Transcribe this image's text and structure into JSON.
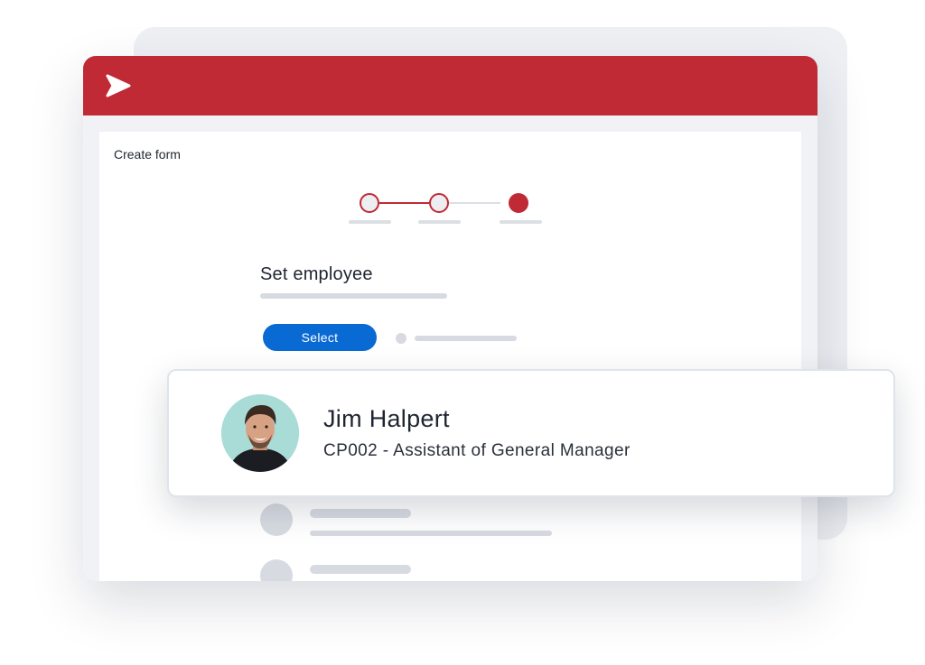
{
  "form": {
    "title": "Create form"
  },
  "stepper": {
    "steps": [
      {
        "state": "visited"
      },
      {
        "state": "visited"
      },
      {
        "state": "active"
      }
    ]
  },
  "section": {
    "title": "Set employee",
    "select_label": "Select"
  },
  "employee": {
    "name": "Jim Halpert",
    "role": "CP002 - Assistant of General Manager",
    "avatar_icon": "person-photo"
  },
  "colors": {
    "brand_red": "#c02a35",
    "select_blue": "#0a6ad3",
    "placeholder_gray": "#d7dbe1"
  },
  "icons": {
    "logo": "chevron-right-logo-icon"
  }
}
